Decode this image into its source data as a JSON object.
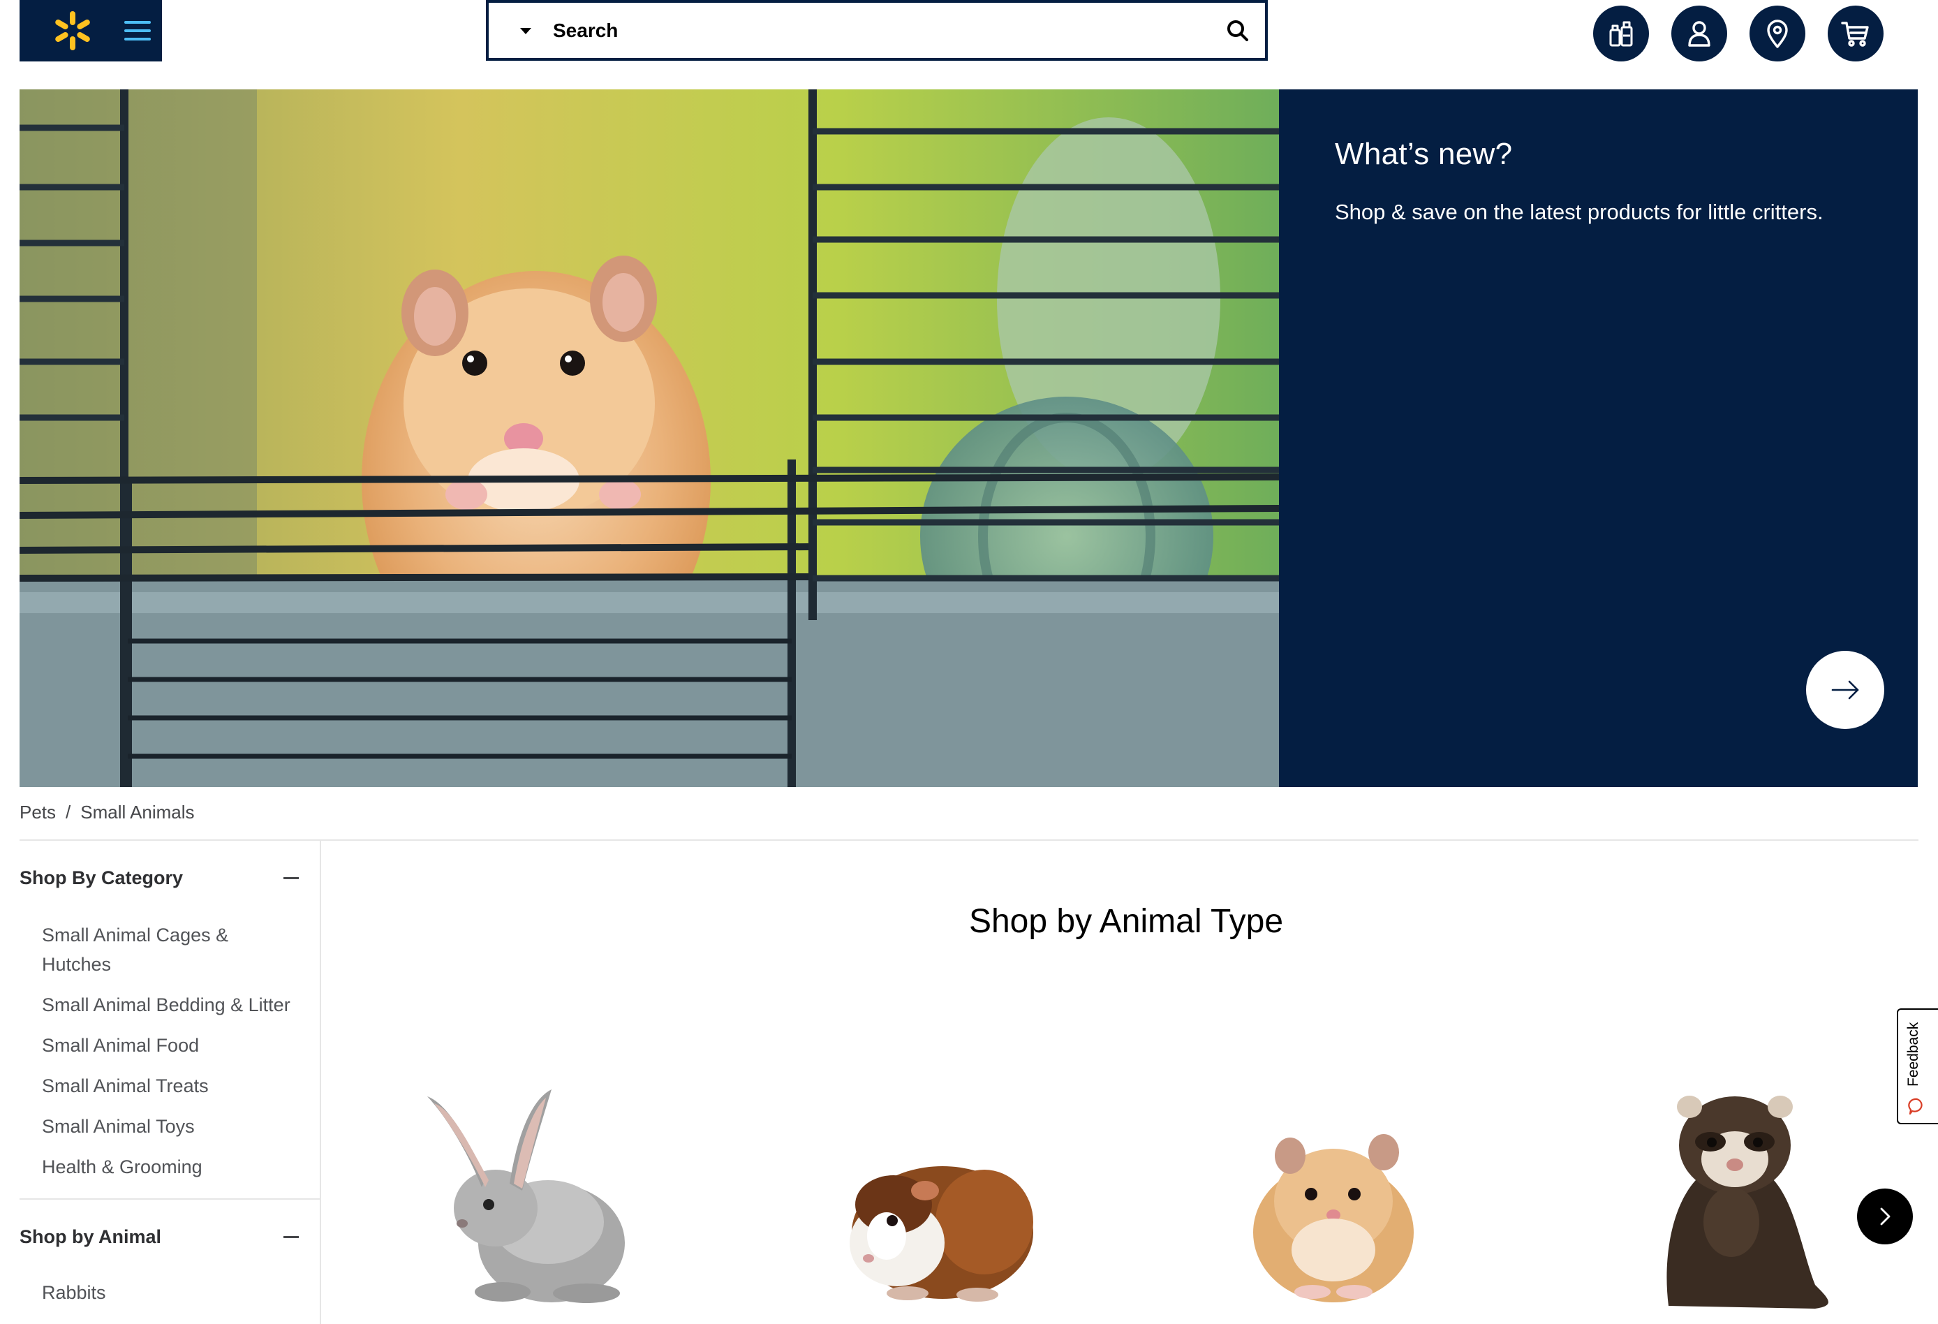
{
  "header": {
    "search": {
      "placeholder": "Search"
    }
  },
  "hero": {
    "title": "What’s new?",
    "subtitle": "Shop & save on the latest products for little critters."
  },
  "breadcrumb": {
    "items": [
      "Pets",
      "Small Animals"
    ],
    "separator": "/"
  },
  "sidebar": {
    "category": {
      "title": "Shop By Category",
      "items": [
        "Small Animal Cages & Hutches",
        "Small Animal Bedding & Litter",
        "Small Animal Food",
        "Small Animal Treats",
        "Small Animal Toys",
        "Health & Grooming"
      ]
    },
    "animal": {
      "title": "Shop by Animal",
      "items": [
        "Rabbits"
      ]
    }
  },
  "main": {
    "section_title": "Shop by Animal Type"
  },
  "feedback": {
    "label": "Feedback"
  },
  "colors": {
    "navy": "#041e42",
    "spark_yellow": "#ffc220",
    "menu_blue": "#4dbdf5"
  }
}
